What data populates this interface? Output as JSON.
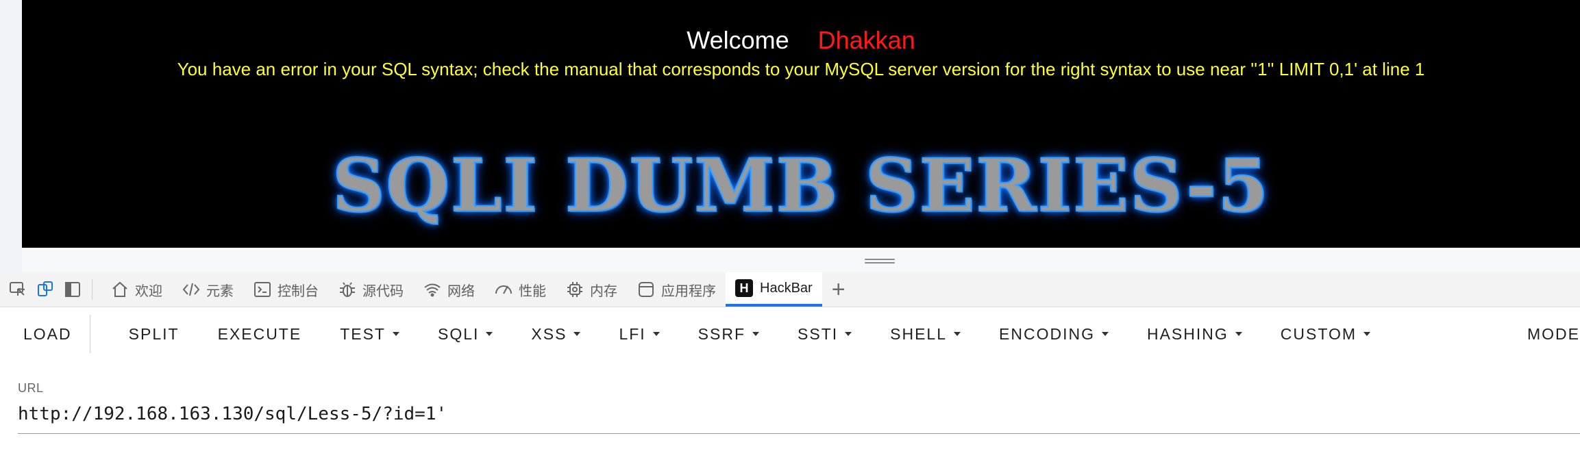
{
  "webpage": {
    "welcome": "Welcome",
    "name": "Dhakkan",
    "error": "You have an error in your SQL syntax; check the manual that corresponds to your MySQL server version for the right syntax to use near ''1'' LIMIT 0,1' at line 1",
    "banner": "SQLI DUMB SERIES-5",
    "colors": {
      "background": "#000000",
      "name": "#ff1a1a",
      "error": "#ffff33"
    }
  },
  "devtools": {
    "tools": [
      "inspect-icon",
      "device-emulation-icon",
      "dock-sidebar-icon"
    ],
    "tabs": [
      {
        "icon": "home-icon",
        "label": "欢迎"
      },
      {
        "icon": "code-tags-icon",
        "label": "元素"
      },
      {
        "icon": "console-icon",
        "label": "控制台"
      },
      {
        "icon": "bug-icon",
        "label": "源代码"
      },
      {
        "icon": "wifi-icon",
        "label": "网络"
      },
      {
        "icon": "gauge-icon",
        "label": "性能"
      },
      {
        "icon": "chip-icon",
        "label": "内存"
      },
      {
        "icon": "app-window-icon",
        "label": "应用程序"
      },
      {
        "icon": "hackbar-logo",
        "label": "HackBar",
        "active": true
      }
    ],
    "hackbar_logo_letter": "H",
    "add_tab": "+",
    "accent": "#1a73e8"
  },
  "hackbar": {
    "buttons": {
      "load": "LOAD",
      "split": "SPLIT",
      "execute": "EXECUTE",
      "test": "TEST",
      "sqli": "SQLI",
      "xss": "XSS",
      "lfi": "LFI",
      "ssrf": "SSRF",
      "ssti": "SSTI",
      "shell": "SHELL",
      "encoding": "ENCODING",
      "hashing": "HASHING",
      "custom": "CUSTOM",
      "mode": "MODE"
    },
    "url_label": "URL",
    "url_value": "http://192.168.163.130/sql/Less-5/?id=1'"
  }
}
